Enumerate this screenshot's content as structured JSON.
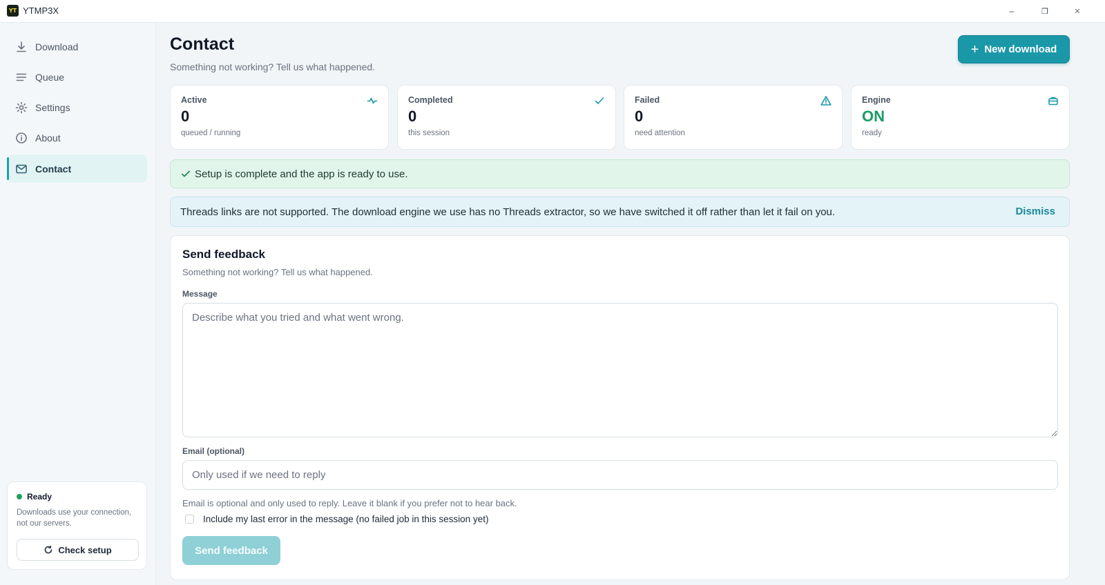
{
  "window": {
    "logo_text": "YT",
    "title": "YTMP3X",
    "minimize": "–",
    "maximize": "❐",
    "close": "✕"
  },
  "sidebar": {
    "items": [
      {
        "label": "Download",
        "icon": "download-icon",
        "active": false
      },
      {
        "label": "Queue",
        "icon": "queue-icon",
        "active": false
      },
      {
        "label": "Settings",
        "icon": "gear-icon",
        "active": false
      },
      {
        "label": "About",
        "icon": "info-icon",
        "active": false
      },
      {
        "label": "Contact",
        "icon": "mail-icon",
        "active": true
      }
    ],
    "status": {
      "label": "Ready",
      "description": "Downloads use your connection, not our servers.",
      "button_label": "Check setup"
    }
  },
  "header": {
    "title": "Contact",
    "subtitle": "Something not working? Tell us what happened.",
    "new_download_label": "New download"
  },
  "stats": [
    {
      "label": "Active",
      "value": "0",
      "sub": "queued / running",
      "icon": "activity-icon"
    },
    {
      "label": "Completed",
      "value": "0",
      "sub": "this session",
      "icon": "check-icon"
    },
    {
      "label": "Failed",
      "value": "0",
      "sub": "need attention",
      "icon": "warning-icon"
    },
    {
      "label": "Engine",
      "value": "ON",
      "sub": "ready",
      "icon": "briefcase-icon"
    }
  ],
  "banners": {
    "success": "Setup is complete and the app is ready to use.",
    "info": "Threads links are not supported. The download engine we use has no Threads extractor, so we have switched it off rather than let it fail on you.",
    "dismiss_label": "Dismiss"
  },
  "feedback": {
    "title": "Send feedback",
    "subtitle": "Something not working? Tell us what happened.",
    "message_label": "Message",
    "message_value": "",
    "message_placeholder": "Describe what you tried and what went wrong.",
    "email_label": "Email (optional)",
    "email_value": "",
    "email_placeholder": "Only used if we need to reply",
    "email_help": "Email is optional and only used to reply. Leave it blank if you prefer not to hear back.",
    "include_error_label": "Include my last error in the message (no failed job in this session yet)",
    "include_error_checked": false,
    "send_label": "Send feedback"
  },
  "colors": {
    "accent": "#1a98a8",
    "success": "#1b9b63",
    "active_nav_bg": "#e2f3f4"
  }
}
